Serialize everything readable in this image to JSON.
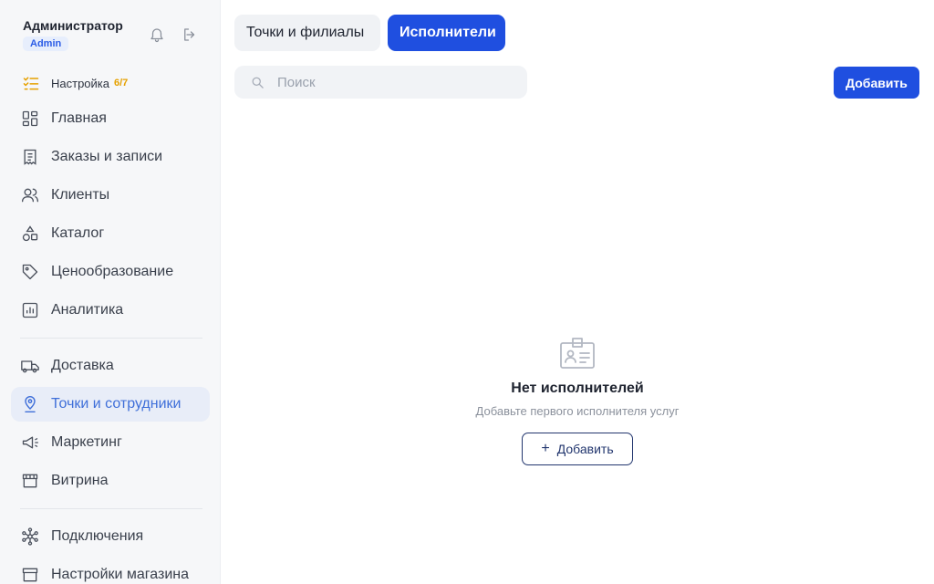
{
  "user": {
    "name": "Администратор",
    "role": "Admin"
  },
  "setup": {
    "label": "Настройка",
    "progress": "6/7"
  },
  "nav": {
    "home": "Главная",
    "orders": "Заказы и записи",
    "clients": "Клиенты",
    "catalog": "Каталог",
    "pricing": "Ценообразование",
    "analytics": "Аналитика",
    "delivery": "Доставка",
    "points_staff": "Точки и сотрудники",
    "marketing": "Маркетинг",
    "storefront": "Витрина",
    "connections": "Подключения",
    "store_settings": "Настройки магазина"
  },
  "tabs": {
    "points": "Точки и филиалы",
    "executors": "Исполнители"
  },
  "search": {
    "placeholder": "Поиск",
    "value": ""
  },
  "toolbar": {
    "add_label": "Добавить"
  },
  "empty_state": {
    "title": "Нет исполнителей",
    "subtitle": "Добавьте первого исполнителя услуг",
    "add_label": "Добавить"
  },
  "colors": {
    "accent": "#1f4fe0",
    "active_nav_bg": "#e8edf8",
    "active_nav_text": "#3f6fd9",
    "setup_count": "#e6a100"
  }
}
